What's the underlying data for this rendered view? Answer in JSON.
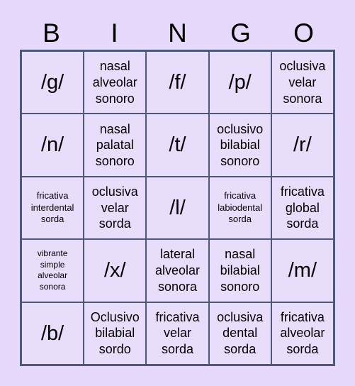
{
  "card": {
    "header_letters": [
      "B",
      "I",
      "N",
      "G",
      "O"
    ],
    "colors": {
      "page_background": "#E7D9FB",
      "cell_background": "#E9DDFC",
      "grid_line": "#4E5878",
      "text": "#000000"
    },
    "rows": [
      [
        {
          "text": "/g/",
          "size": "phoneme"
        },
        {
          "text": "nasal\nalveolar\nsonoro",
          "size": "large"
        },
        {
          "text": "/f/",
          "size": "phoneme"
        },
        {
          "text": "/p/",
          "size": "phoneme"
        },
        {
          "text": "oclusiva\nvelar\nsonora",
          "size": "large"
        }
      ],
      [
        {
          "text": "/n/",
          "size": "phoneme"
        },
        {
          "text": "nasal\npalatal\nsonoro",
          "size": "large"
        },
        {
          "text": "/t/",
          "size": "phoneme"
        },
        {
          "text": "oclusivo\nbilabial\nsonoro",
          "size": "large"
        },
        {
          "text": "/r/",
          "size": "phoneme"
        }
      ],
      [
        {
          "text": "fricativa\ninterdental\nsorda",
          "size": "small"
        },
        {
          "text": "oclusiva\nvelar\nsorda",
          "size": "large"
        },
        {
          "text": "/l/",
          "size": "phoneme"
        },
        {
          "text": "fricativa\nlabiodental\nsorda",
          "size": "small"
        },
        {
          "text": "fricativa\nglobal\nsorda",
          "size": "large"
        }
      ],
      [
        {
          "text": "vibrante\nsimple\nalveolar\nsonora",
          "size": "xsmall"
        },
        {
          "text": "/x/",
          "size": "phoneme"
        },
        {
          "text": "lateral\nalveolar\nsonora",
          "size": "large"
        },
        {
          "text": "nasal\nbilabial\nsonoro",
          "size": "large"
        },
        {
          "text": "/m/",
          "size": "phoneme"
        }
      ],
      [
        {
          "text": "/b/",
          "size": "phoneme"
        },
        {
          "text": "Oclusivo\nbilabial\nsordo",
          "size": "large"
        },
        {
          "text": "fricativa\nvelar\nsorda",
          "size": "large"
        },
        {
          "text": "oclusiva\ndental\nsorda",
          "size": "large"
        },
        {
          "text": "fricativa\nalveolar\nsorda",
          "size": "large"
        }
      ]
    ]
  }
}
